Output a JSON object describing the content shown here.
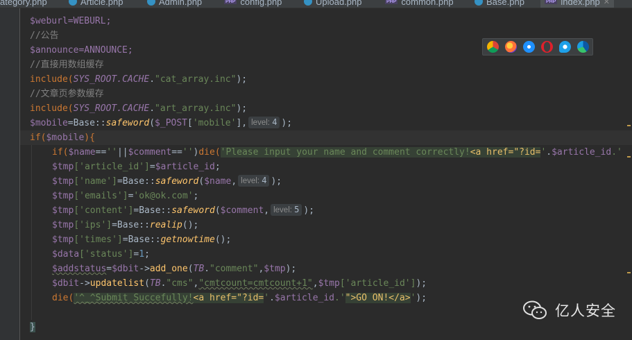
{
  "tabs": [
    {
      "label": "ategory.php",
      "icon": "php-icon"
    },
    {
      "label": "Article.php",
      "icon": "class-icon"
    },
    {
      "label": "Admin.php",
      "icon": "class-icon"
    },
    {
      "label": "config.php",
      "icon": "php-icon"
    },
    {
      "label": "Upload.php",
      "icon": "class-icon"
    },
    {
      "label": "common.php",
      "icon": "php-icon"
    },
    {
      "label": "Base.php",
      "icon": "class-icon"
    },
    {
      "label": "index.php",
      "icon": "php-icon",
      "active": true
    }
  ],
  "code": {
    "l0": "$weburl=WEBURL;",
    "l1": "//公告",
    "l2": "$announce=ANNOUNCE;",
    "l3": "//直接用数组缓存",
    "l4a": "include(",
    "l4b": "SYS_ROOT.CACHE",
    "l4c": ".",
    "l4d": "\"cat_array.inc\"",
    "l4e": ");",
    "l5": "//文章页参数缓存",
    "l6a": "include(",
    "l6b": "SYS_ROOT.CACHE",
    "l6c": ".",
    "l6d": "\"art_array.inc\"",
    "l6e": ");",
    "l7a": "$mobile",
    "l7b": "=Base::",
    "l7c": "safeword",
    "l7d": "(",
    "l7e": "$_POST",
    "l7f": "[",
    "l7g": "'mobile'",
    "l7h": "],",
    "hint_label": "level:",
    "l7_hint": "4",
    "l7i": ");",
    "l8a": "if(",
    "l8b": "$mobile",
    "l8c": "){",
    "l9a": "if(",
    "l9b": "$name",
    "l9c": "==",
    "l9d": "''",
    "l9e": "||",
    "l9f": "$comment",
    "l9g": "==",
    "l9h": "''",
    "l9i": ")",
    "l9j": "die(",
    "l9k": "'Please input your name and comment correctly!",
    "l9l": "<a href=\"?id=",
    "l9m": "'",
    "l9n": ".",
    "l9o": "$article_id",
    "l9p": ".'",
    "l10a": "$tmp",
    "l10b": "['article_id']",
    "l10c": "=",
    "l10d": "$article_id",
    "l10e": ";",
    "l11a": "$tmp",
    "l11b": "['name']",
    "l11c": "=Base::",
    "l11d": "safeword",
    "l11e": "(",
    "l11f": "$name",
    "l11g": ",",
    "l11_hint": "4",
    "l11h": ");",
    "l12a": "$tmp",
    "l12b": "['emails']",
    "l12c": "=",
    "l12d": "'ok@ok.com'",
    "l12e": ";",
    "l13a": "$tmp",
    "l13b": "['content']",
    "l13c": "=Base::",
    "l13d": "safeword",
    "l13e": "(",
    "l13f": "$comment",
    "l13g": ",",
    "l13_hint": "5",
    "l13h": ");",
    "l14a": "$tmp",
    "l14b": "['ips']",
    "l14c": "=Base::",
    "l14d": "realip",
    "l14e": "();",
    "l15a": "$tmp",
    "l15b": "['times']",
    "l15c": "=Base::",
    "l15d": "getnowtime",
    "l15e": "();",
    "l16a": "$data",
    "l16b": "['status']",
    "l16c": "=",
    "l16d": "1",
    "l16e": ";",
    "l17a": "$addstatus",
    "l17b": "=",
    "l17c": "$dbit",
    "l17d": "->",
    "l17e": "add_one",
    "l17f": "(",
    "l17g": "TB",
    "l17h": ".",
    "l17i": "\"comment\"",
    "l17j": ",",
    "l17k": "$tmp",
    "l17l": ");",
    "l18a": "$dbit",
    "l18b": "->",
    "l18c": "updatelist",
    "l18d": "(",
    "l18e": "TB",
    "l18f": ".",
    "l18g": "\"cms\"",
    "l18h": ",",
    "l18i": "\"cmtcount=cmtcount+1\"",
    "l18j": ",",
    "l18k": "$tmp",
    "l18l": "['article_id']",
    "l18m": ");",
    "l19a": "die(",
    "l19b": "'^_^Submit Succefully!",
    "l19c": "<a href=\"?id=",
    "l19d": "'",
    "l19e": ".",
    "l19f": "$article_id",
    "l19g": ".'",
    "l19h": "\">GO ON!</a>",
    "l19i": "'",
    "l19j": ");",
    "l20": "}"
  },
  "browsers": [
    "chrome-icon",
    "firefox-icon",
    "safari-icon",
    "opera-icon",
    "ie-icon",
    "edge-icon"
  ],
  "brand": {
    "name": "亿人安全"
  }
}
